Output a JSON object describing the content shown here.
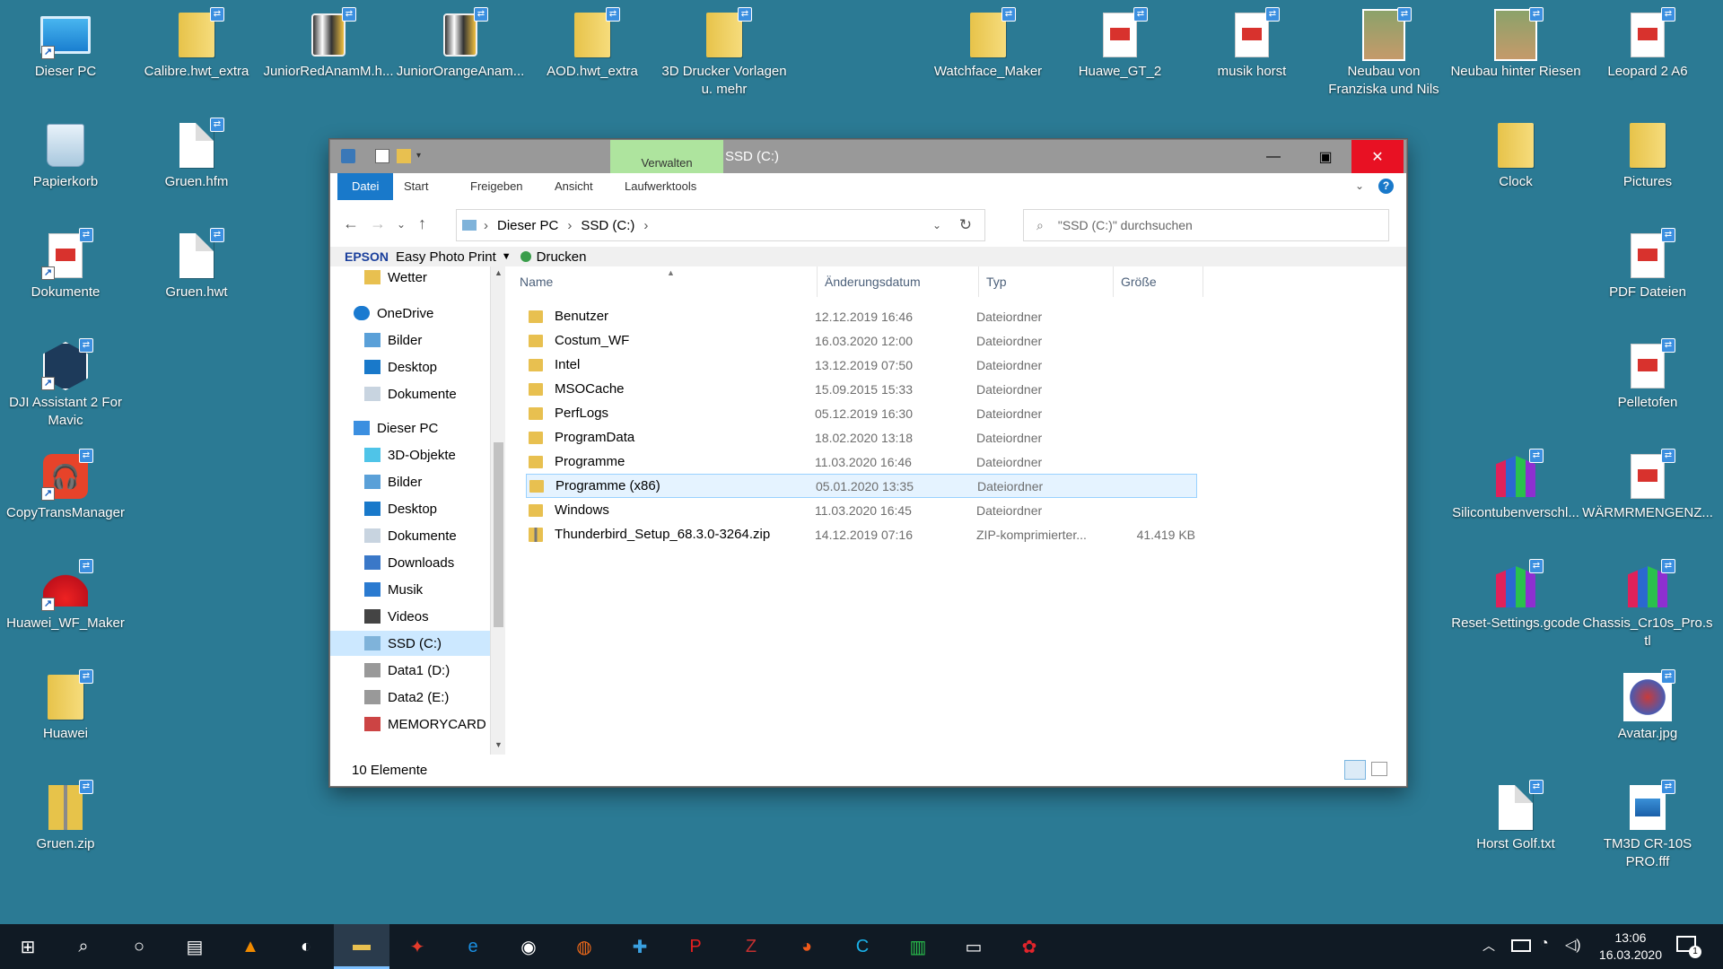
{
  "desktop_icons": [
    {
      "label": "Dieser PC",
      "icon": "computer-icon"
    },
    {
      "label": "Calibre.hwt_extra",
      "icon": "folder-icon"
    },
    {
      "label": "JuniorRedAnamM.h...",
      "icon": "watchface-file-icon"
    },
    {
      "label": "JuniorOrangeAnam...",
      "icon": "watchface-file-icon"
    },
    {
      "label": "AOD.hwt_extra",
      "icon": "folder-icon"
    },
    {
      "label": "3D Drucker Vorlagen u. mehr",
      "icon": "folder-icon"
    },
    {
      "label": "Watchface_Maker",
      "icon": "folder-icon"
    },
    {
      "label": "Huawe_GT_2",
      "icon": "pdf-icon"
    },
    {
      "label": "musik horst",
      "icon": "music-folder-icon"
    },
    {
      "label": "Neubau von Franziska und Nils",
      "icon": "photo-folder-icon"
    },
    {
      "label": "Neubau hinter Riesen",
      "icon": "photo-folder-icon"
    },
    {
      "label": "Leopard 2 A6",
      "icon": "pdf-icon"
    },
    {
      "label": "Papierkorb",
      "icon": "recycle-bin-icon"
    },
    {
      "label": "Gruen.hfm",
      "icon": "file-icon"
    },
    {
      "label": "Clock",
      "icon": "folder-icon"
    },
    {
      "label": "Pictures",
      "icon": "folder-icon"
    },
    {
      "label": "Dokumente",
      "icon": "pdf-icon"
    },
    {
      "label": "Gruen.hwt",
      "icon": "file-icon"
    },
    {
      "label": "PDF Dateien",
      "icon": "pdf-icon"
    },
    {
      "label": "DJI Assistant 2 For Mavic",
      "icon": "dji-icon"
    },
    {
      "label": "Pelletofen",
      "icon": "pdf-icon"
    },
    {
      "label": "CopyTransManager",
      "icon": "copytrans-icon"
    },
    {
      "label": "Silicontubenverschl...",
      "icon": "slicer-file-icon"
    },
    {
      "label": "WÄRMRMENGENZ...",
      "icon": "pdf-icon"
    },
    {
      "label": "Huawei_WF_Maker",
      "icon": "huawei-icon"
    },
    {
      "label": "Reset-Settings.gcode",
      "icon": "slicer-file-icon"
    },
    {
      "label": "Chassis_Cr10s_Pro.stl",
      "icon": "slicer-file-icon"
    },
    {
      "label": "Huawei",
      "icon": "folder-icon"
    },
    {
      "label": "Avatar.jpg",
      "icon": "avatar-image-icon"
    },
    {
      "label": "Gruen.zip",
      "icon": "zip-icon"
    },
    {
      "label": "Horst Golf.txt",
      "icon": "text-file-icon"
    },
    {
      "label": "TM3D CR-10S PRO.fff",
      "icon": "image-file-icon"
    }
  ],
  "window": {
    "title": "SSD (C:)",
    "context_tab": "Verwalten",
    "ribbon_tabs": [
      "Datei",
      "Start",
      "Freigeben",
      "Ansicht",
      "Laufwerktools"
    ],
    "breadcrumb": [
      "Dieser PC",
      "SSD (C:)"
    ],
    "search_placeholder": "\"SSD (C:)\" durchsuchen",
    "epson_brand": "EPSON",
    "epson_app": "Easy Photo Print",
    "print_label": "Drucken",
    "nav_items": [
      {
        "label": "Wetter",
        "icon": "folder-icon",
        "level": 2
      },
      {
        "label": "OneDrive",
        "icon": "onedrive-icon",
        "level": 1
      },
      {
        "label": "Bilder",
        "icon": "pictures-icon",
        "level": 2
      },
      {
        "label": "Desktop",
        "icon": "desktop-icon",
        "level": 2
      },
      {
        "label": "Dokumente",
        "icon": "documents-icon",
        "level": 2
      },
      {
        "label": "Dieser PC",
        "icon": "computer-icon",
        "level": 1
      },
      {
        "label": "3D-Objekte",
        "icon": "3d-objects-icon",
        "level": 2
      },
      {
        "label": "Bilder",
        "icon": "pictures-icon",
        "level": 2
      },
      {
        "label": "Desktop",
        "icon": "desktop-icon",
        "level": 2
      },
      {
        "label": "Dokumente",
        "icon": "documents-icon",
        "level": 2
      },
      {
        "label": "Downloads",
        "icon": "downloads-icon",
        "level": 2
      },
      {
        "label": "Musik",
        "icon": "music-icon",
        "level": 2
      },
      {
        "label": "Videos",
        "icon": "videos-icon",
        "level": 2
      },
      {
        "label": "SSD (C:)",
        "icon": "windows-drive-icon",
        "level": 2,
        "selected": true
      },
      {
        "label": "Data1 (D:)",
        "icon": "drive-icon",
        "level": 2
      },
      {
        "label": "Data2 (E:)",
        "icon": "drive-icon",
        "level": 2
      },
      {
        "label": "MEMORYCARD",
        "icon": "drive-error-icon",
        "level": 2
      }
    ],
    "columns": [
      "Name",
      "Änderungsdatum",
      "Typ",
      "Größe"
    ],
    "files": [
      {
        "name": "Benutzer",
        "date": "12.12.2019 16:46",
        "type": "Dateiordner",
        "size": ""
      },
      {
        "name": "Costum_WF",
        "date": "16.03.2020 12:00",
        "type": "Dateiordner",
        "size": ""
      },
      {
        "name": "Intel",
        "date": "13.12.2019 07:50",
        "type": "Dateiordner",
        "size": ""
      },
      {
        "name": "MSOCache",
        "date": "15.09.2015 15:33",
        "type": "Dateiordner",
        "size": ""
      },
      {
        "name": "PerfLogs",
        "date": "05.12.2019 16:30",
        "type": "Dateiordner",
        "size": ""
      },
      {
        "name": "ProgramData",
        "date": "18.02.2020 13:18",
        "type": "Dateiordner",
        "size": ""
      },
      {
        "name": "Programme",
        "date": "11.03.2020 16:46",
        "type": "Dateiordner",
        "size": ""
      },
      {
        "name": "Programme (x86)",
        "date": "05.01.2020 13:35",
        "type": "Dateiordner",
        "size": "",
        "selected": true
      },
      {
        "name": "Windows",
        "date": "11.03.2020 16:45",
        "type": "Dateiordner",
        "size": ""
      },
      {
        "name": "Thunderbird_Setup_68.3.0-3264.zip",
        "date": "14.12.2019 07:16",
        "type": "ZIP-komprimierter...",
        "size": "41.419 KB"
      }
    ],
    "status": "10 Elemente"
  },
  "taskbar": {
    "time": "13:06",
    "date": "16.03.2020",
    "notification_count": "1",
    "apps": [
      "start-icon",
      "search-icon",
      "cortana-icon",
      "task-view-icon",
      "vlc-icon",
      "app-bird-icon",
      "file-explorer-icon",
      "app-red-icon",
      "edge-icon",
      "app-globe-icon",
      "firefox-icon",
      "app-ribbon-icon",
      "app-p-icon",
      "filezilla-icon",
      "app-orange-icon",
      "app-c-icon",
      "app-bars-icon",
      "app-device-icon",
      "huawei-icon"
    ]
  }
}
